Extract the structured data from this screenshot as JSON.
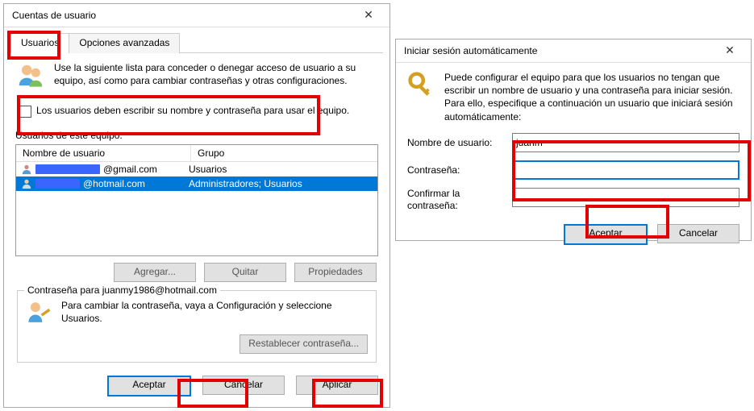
{
  "win1": {
    "title": "Cuentas de usuario",
    "tabs": {
      "users": "Usuarios",
      "advanced": "Opciones avanzadas"
    },
    "intro": "Use la siguiente lista para conceder o denegar acceso de usuario a su equipo, así como para cambiar contraseñas y otras configuraciones.",
    "checkbox_label": "Los usuarios deben escribir su nombre y contraseña para usar el equipo.",
    "list_label": "Usuarios de este equipo:",
    "cols": {
      "name": "Nombre de usuario",
      "group": "Grupo"
    },
    "rows": [
      {
        "suffix": "@gmail.com",
        "group": "Usuarios",
        "selected": false
      },
      {
        "suffix": "@hotmail.com",
        "group": "Administradores; Usuarios",
        "selected": true
      }
    ],
    "btns": {
      "add": "Agregar...",
      "remove": "Quitar",
      "props": "Propiedades"
    },
    "pw_box": {
      "legend": "Contraseña para juanmy1986@hotmail.com",
      "text": "Para cambiar la contraseña, vaya a Configuración y seleccione Usuarios.",
      "reset": "Restablecer contraseña..."
    },
    "footer": {
      "ok": "Aceptar",
      "cancel": "Cancelar",
      "apply": "Aplicar"
    }
  },
  "win2": {
    "title": "Iniciar sesión automáticamente",
    "intro": "Puede configurar el equipo para que los usuarios no tengan que escribir un nombre de usuario y una contraseña para iniciar sesión. Para ello, especifique a continuación un usuario que iniciará sesión automáticamente:",
    "labels": {
      "user": "Nombre de usuario:",
      "pw": "Contraseña:",
      "confirm": "Confirmar la contraseña:"
    },
    "values": {
      "user": "juanm",
      "pw": "",
      "confirm": ""
    },
    "footer": {
      "ok": "Aceptar",
      "cancel": "Cancelar"
    }
  }
}
